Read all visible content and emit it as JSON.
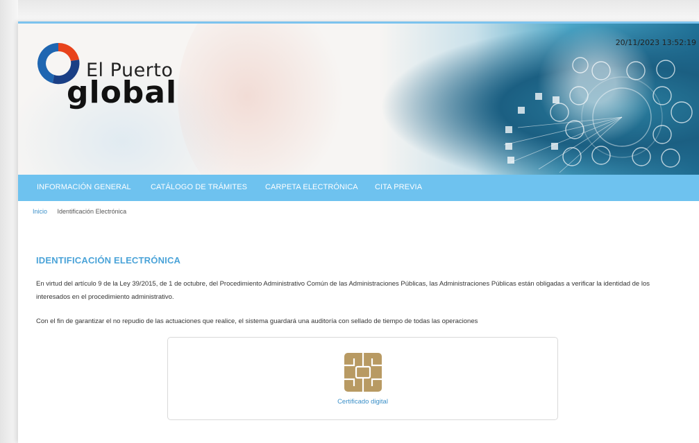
{
  "brand": {
    "line1": "El Puerto",
    "line2": "global"
  },
  "header": {
    "timestamp": "20/11/2023 13:52:19"
  },
  "nav": {
    "items": [
      {
        "label": "INFORMACIÓN GENERAL"
      },
      {
        "label": "CATÁLOGO DE TRÁMITES"
      },
      {
        "label": "CARPETA ELECTRÓNICA"
      },
      {
        "label": "CITA PREVIA"
      }
    ]
  },
  "breadcrumb": {
    "home": "Inicio",
    "current": "Identificación Electrónica"
  },
  "main": {
    "title": "IDENTIFICACIÓN ELECTRÓNICA",
    "paragraph1": "En virtud del artículo 9 de la Ley 39/2015, de 1 de octubre, del Procedimiento Administrativo Común de las Administraciones Públicas, las Administraciones Públicas están obligadas a verificar la identidad de los interesados en el procedimiento administrativo.",
    "paragraph2": "Con el fin de garantizar el no repudio de las actuaciones que realice, el sistema guardará una auditoría con sellado de tiempo de todas las operaciones"
  },
  "card": {
    "label": "Certificado digital",
    "icon": "smart-card-chip-icon"
  },
  "colors": {
    "nav": "#6ec2ef",
    "accent": "#4aa3d8",
    "link": "#3a8fc8",
    "chip": "#b89a63"
  }
}
